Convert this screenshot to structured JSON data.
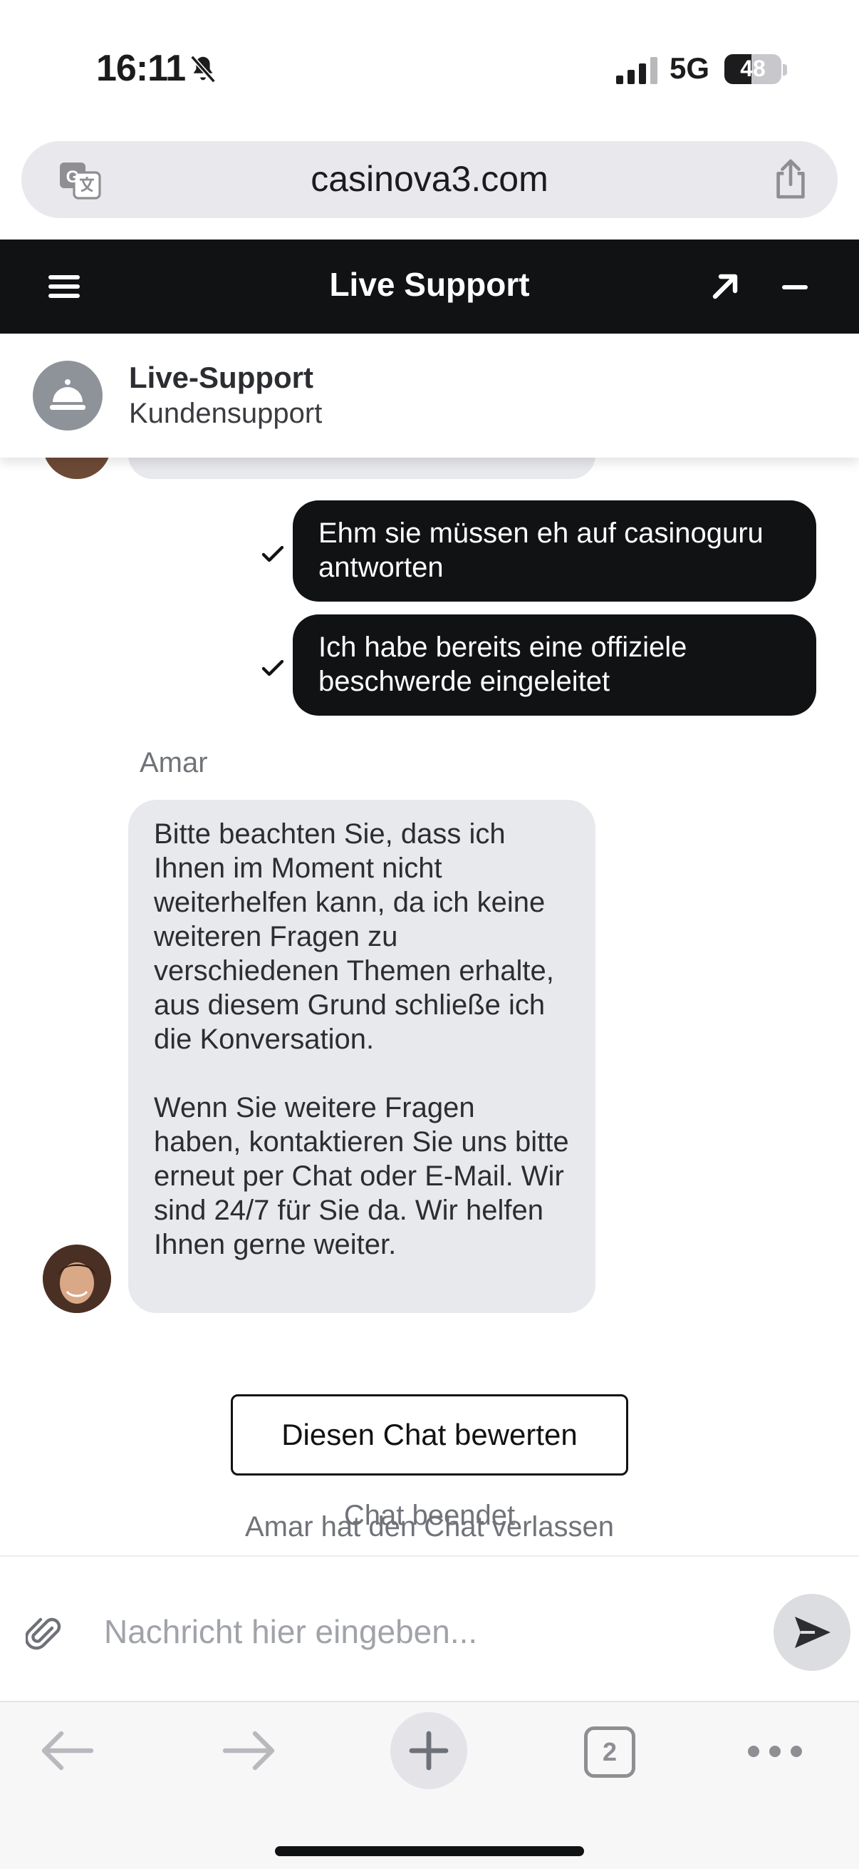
{
  "status_bar": {
    "time": "16:11",
    "network": "5G",
    "battery": "48",
    "battery_level": 0.48
  },
  "browser": {
    "url": "casinova3.com",
    "open_tabs": "2"
  },
  "chat_header": {
    "title": "Live Support"
  },
  "agent_card": {
    "name": "Live-Support",
    "subtitle": "Kundensupport"
  },
  "messages": {
    "outgoing": [
      {
        "text": "Ehm sie müssen eh auf casinoguru antworten"
      },
      {
        "text": "Ich habe bereits eine offiziele beschwerde eingeleitet"
      }
    ],
    "agent_name": "Amar",
    "incoming_text": "Bitte beachten Sie, dass ich Ihnen im Moment nicht weiterhelfen kann, da ich keine weiteren Fragen zu verschiedenen Themen erhalte, aus diesem Grund schließe ich die Konversation.\n\nWenn Sie weitere Fragen haben, kontaktieren Sie uns bitte erneut per Chat oder E-Mail. Wir sind 24/7 für Sie da. Wir helfen Ihnen gerne weiter."
  },
  "system": {
    "left_notice": "Amar hat den Chat verlassen",
    "rate_button": "Diesen Chat bewerten",
    "ended_notice": "Chat beendet"
  },
  "composer": {
    "placeholder": "Nachricht hier eingeben..."
  },
  "colors": {
    "header_bg": "#111214",
    "outgoing_bubble": "#111214",
    "incoming_bubble": "#e8e9ec",
    "muted_text": "#707378"
  },
  "icons": [
    "bell-slash-icon",
    "signal-icon",
    "translate-icon",
    "share-icon",
    "menu-icon",
    "expand-icon",
    "minimize-icon",
    "concierge-bell-icon",
    "checkmark-icon",
    "paperclip-icon",
    "send-icon",
    "back-arrow-icon",
    "forward-arrow-icon",
    "plus-icon",
    "tabs-icon",
    "more-icon"
  ]
}
